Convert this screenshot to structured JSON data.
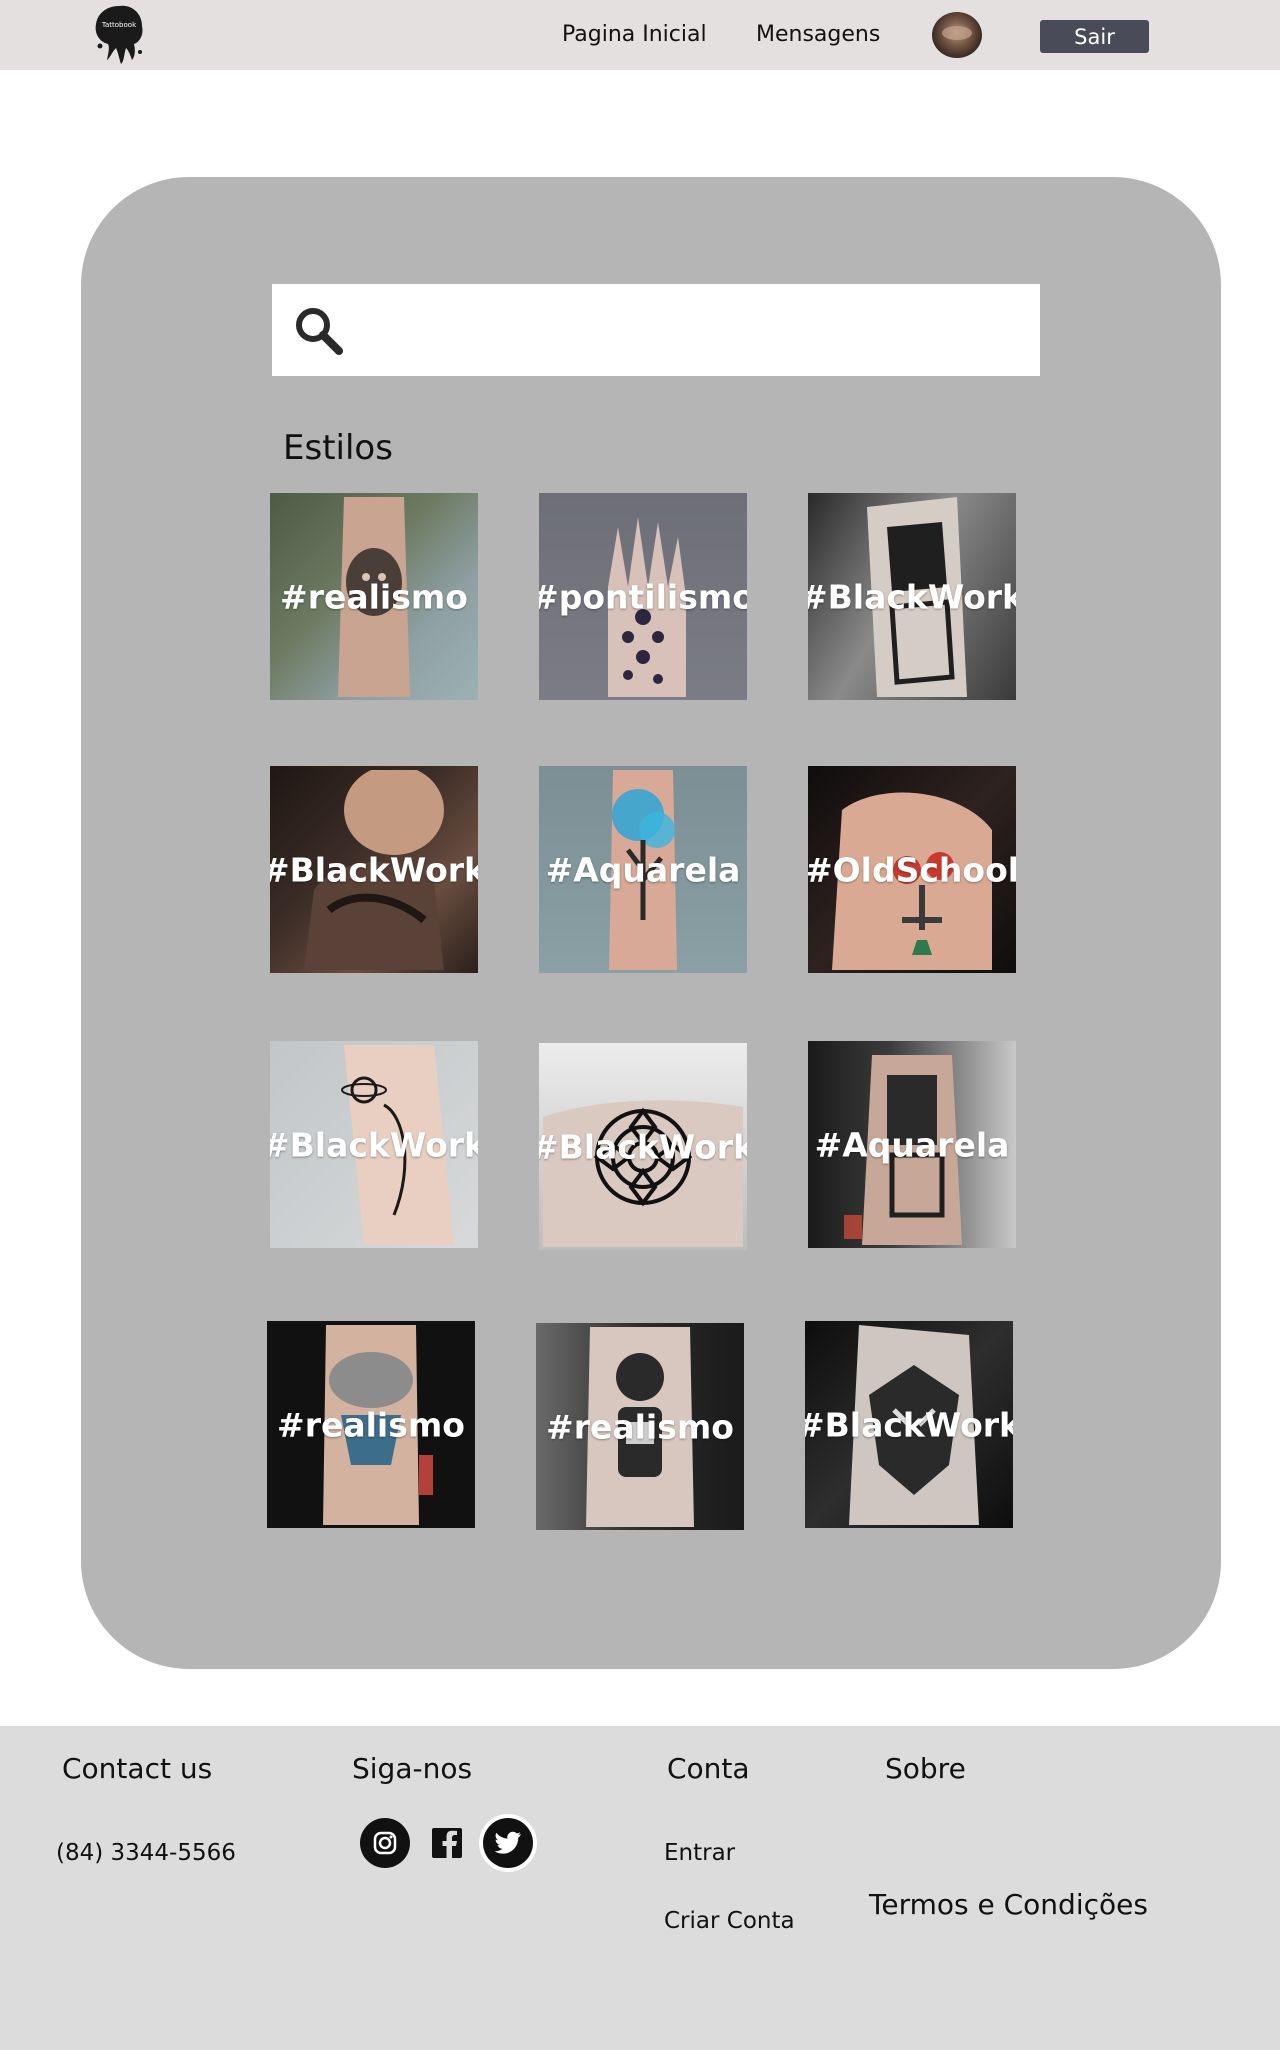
{
  "header": {
    "logo_text": "Tattobook",
    "nav": [
      {
        "label": "Pagina Inicial"
      },
      {
        "label": "Mensagens"
      }
    ],
    "logout_label": "Sair"
  },
  "search": {
    "placeholder": "",
    "value": ""
  },
  "styles": {
    "heading": "Estilos",
    "tiles": [
      {
        "tag": "#realismo",
        "bg": "#5e6b5a"
      },
      {
        "tag": "#pontilismo",
        "bg": "#6e6e78"
      },
      {
        "tag": "#BlackWork",
        "bg": "#6a6a6a"
      },
      {
        "tag": "#BlackWork",
        "bg": "#3a2e2a"
      },
      {
        "tag": "#Aquarela",
        "bg": "#7d9096"
      },
      {
        "tag": "#OldSchool",
        "bg": "#3a2a28"
      },
      {
        "tag": "#BlackWork",
        "bg": "#c9cbcc"
      },
      {
        "tag": "#BlackWork",
        "bg": "#cfcfcf"
      },
      {
        "tag": "#Aquarela",
        "bg": "#5a5a5a"
      },
      {
        "tag": "#realismo",
        "bg": "#1a1a1a"
      },
      {
        "tag": "#realismo",
        "bg": "#4a4a4a"
      },
      {
        "tag": "#BlackWork",
        "bg": "#3a3a3a"
      }
    ]
  },
  "footer": {
    "contact": {
      "heading": "Contact us",
      "phone": "(84) 3344-5566"
    },
    "follow": {
      "heading": "Siga-nos",
      "icons": [
        "instagram-icon",
        "facebook-icon",
        "twitter-icon"
      ]
    },
    "account": {
      "heading": "Conta",
      "login": "Entrar",
      "signup": "Criar Conta"
    },
    "about": {
      "heading": "Sobre",
      "terms": "Termos e Condições"
    }
  }
}
